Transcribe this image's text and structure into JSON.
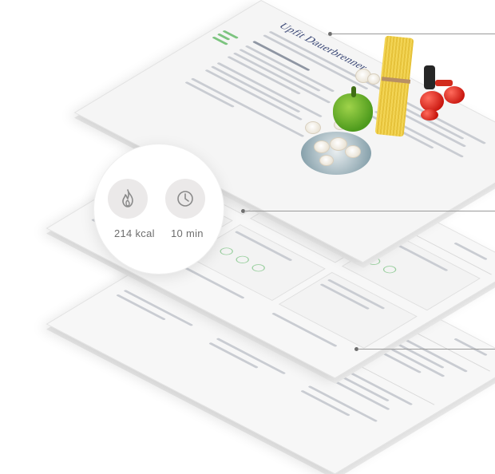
{
  "page": {
    "title": "Upfit Dauerbrenner"
  },
  "stats": {
    "calories": "214 kcal",
    "time": "10 min",
    "calories_icon": "flame-icon",
    "time_icon": "clock-icon"
  },
  "colors": {
    "title": "#3d4a78",
    "accent_green": "#7cc47f",
    "icon_bg": "#ebe9e9",
    "icon_stroke": "#8a8a8a"
  }
}
